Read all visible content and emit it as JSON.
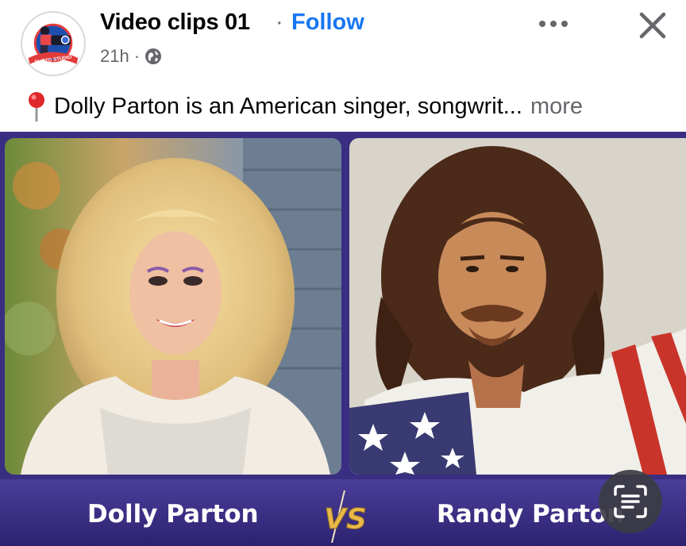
{
  "post": {
    "page_name": "Video clips 01",
    "separator": "·",
    "follow_label": "Follow",
    "time": "21h",
    "meta_separator": "·",
    "privacy_icon": "globe-icon",
    "caption": "Dolly Parton is an American singer, songwrit...",
    "caption_more": "more",
    "avatar_text": "PHOTO STUDIO"
  },
  "media": {
    "left_name": "Dolly Parton",
    "right_name": "Randy Parton",
    "vs_label": "VS"
  },
  "colors": {
    "link": "#1877f2",
    "muted": "#65676b",
    "banner": "#3a2e82",
    "vs_gold": "#e8b84a"
  }
}
